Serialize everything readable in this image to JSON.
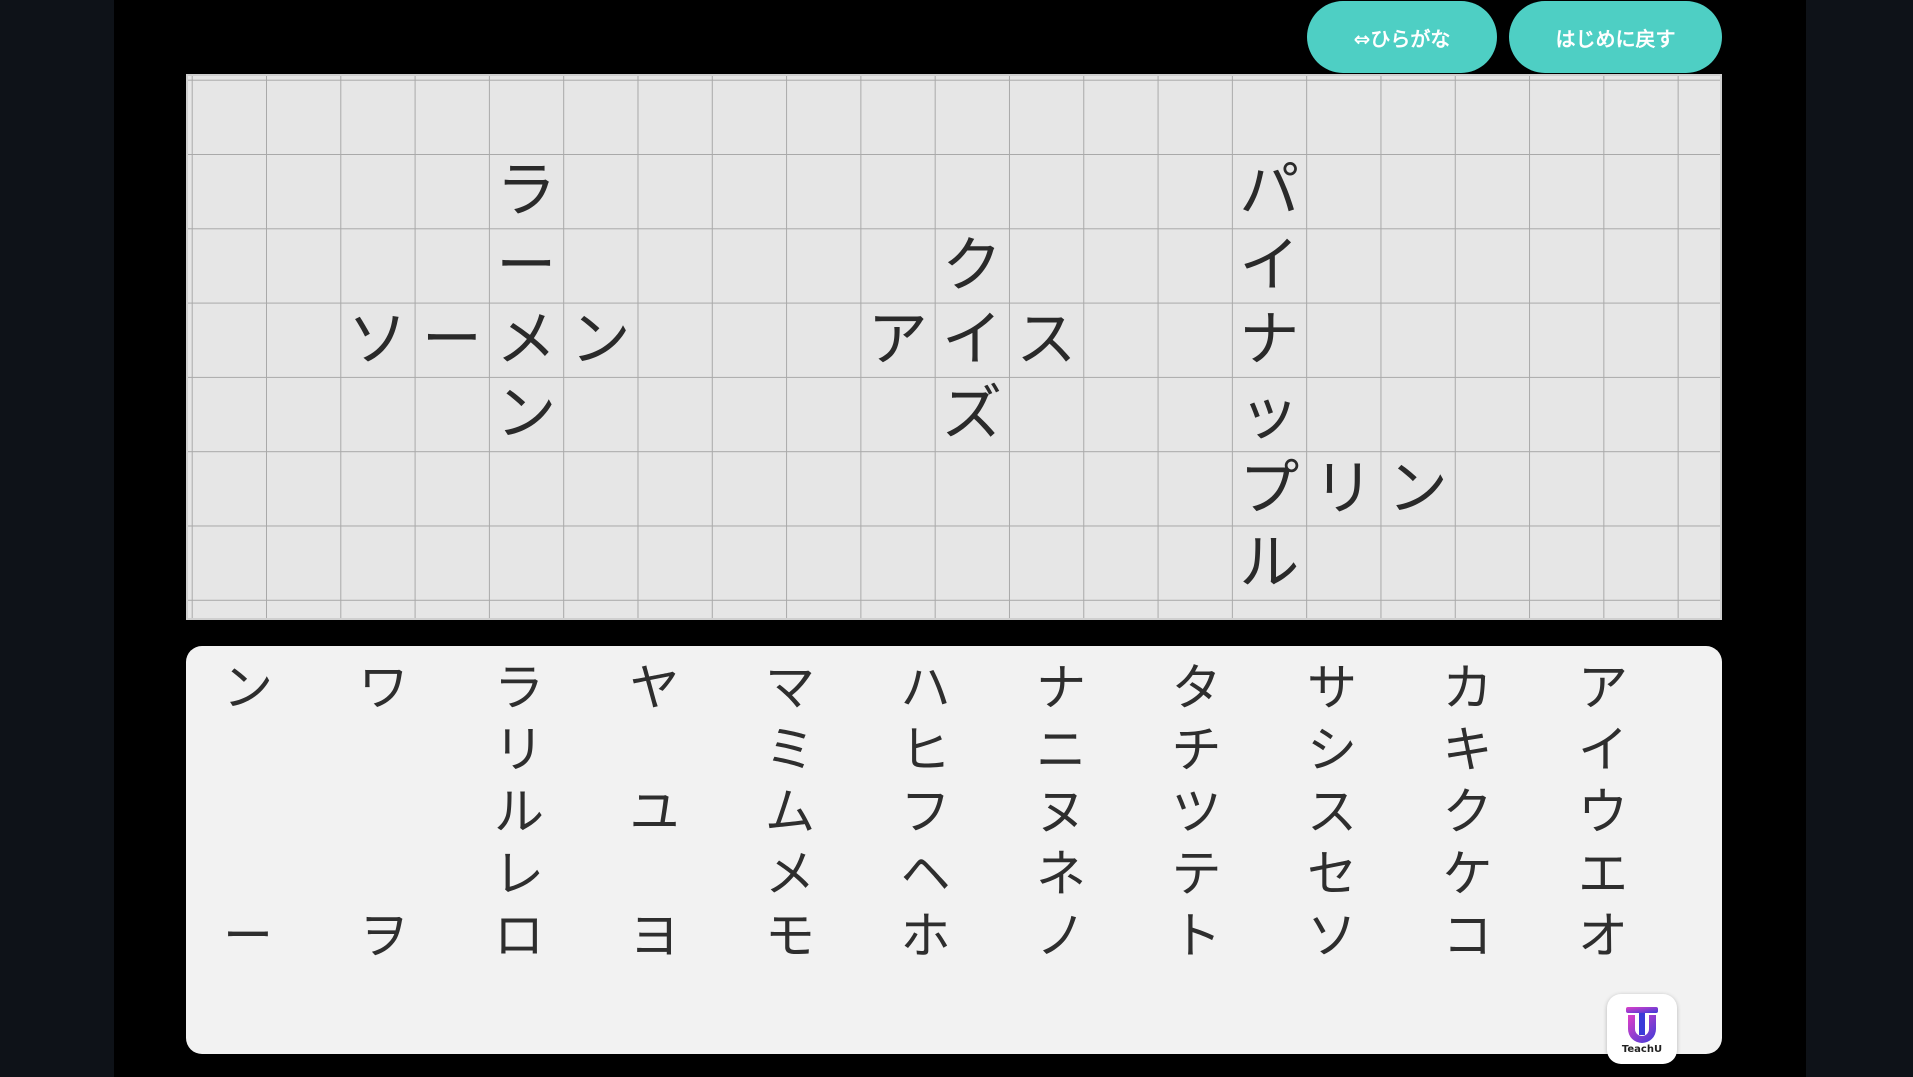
{
  "header": {
    "toggle_label": "⇔ひらがな",
    "reset_label": "はじめに戻す"
  },
  "board": {
    "rows": [
      [
        "",
        "",
        "",
        "",
        "",
        "",
        "",
        "",
        "",
        "",
        "",
        "",
        "",
        "",
        "",
        "",
        "",
        "",
        "",
        "",
        ""
      ],
      [
        "",
        "",
        "",
        "",
        "ラ",
        "",
        "",
        "",
        "",
        "",
        "",
        "",
        "",
        "",
        "パ",
        "",
        "",
        "",
        "",
        "",
        ""
      ],
      [
        "",
        "",
        "",
        "",
        "ー",
        "",
        "",
        "",
        "",
        "",
        "ク",
        "",
        "",
        "",
        "イ",
        "",
        "",
        "",
        "",
        "",
        ""
      ],
      [
        "",
        "",
        "ソ",
        "ー",
        "メ",
        "ン",
        "",
        "",
        "",
        "ア",
        "イ",
        "ス",
        "",
        "",
        "ナ",
        "",
        "",
        "",
        "",
        "",
        ""
      ],
      [
        "",
        "",
        "",
        "",
        "ン",
        "",
        "",
        "",
        "",
        "",
        "ズ",
        "",
        "",
        "",
        "ッ",
        "",
        "",
        "",
        "",
        "",
        ""
      ],
      [
        "",
        "",
        "",
        "",
        "",
        "",
        "",
        "",
        "",
        "",
        "",
        "",
        "",
        "",
        "プ",
        "リ",
        "ン",
        "",
        "",
        "",
        ""
      ],
      [
        "",
        "",
        "",
        "",
        "",
        "",
        "",
        "",
        "",
        "",
        "",
        "",
        "",
        "",
        "ル",
        "",
        "",
        "",
        "",
        "",
        ""
      ]
    ]
  },
  "keyboard": {
    "columns": [
      [
        "ン",
        "",
        "",
        "",
        "ー"
      ],
      [
        "ワ",
        "",
        "",
        "",
        "ヲ"
      ],
      [
        "ラ",
        "リ",
        "ル",
        "レ",
        "ロ"
      ],
      [
        "ヤ",
        "",
        "ユ",
        "",
        "ヨ"
      ],
      [
        "マ",
        "ミ",
        "ム",
        "メ",
        "モ"
      ],
      [
        "ハ",
        "ヒ",
        "フ",
        "ヘ",
        "ホ"
      ],
      [
        "ナ",
        "ニ",
        "ヌ",
        "ネ",
        "ノ"
      ],
      [
        "タ",
        "チ",
        "ツ",
        "テ",
        "ト"
      ],
      [
        "サ",
        "シ",
        "ス",
        "セ",
        "ソ"
      ],
      [
        "カ",
        "キ",
        "ク",
        "ケ",
        "コ"
      ],
      [
        "ア",
        "イ",
        "ウ",
        "エ",
        "オ"
      ]
    ]
  },
  "logo": {
    "text": "TeachU",
    "icon": "teachu-logo-icon"
  },
  "colors": {
    "accent": "#4ecfc4",
    "board_bg": "#e6e6e6",
    "keyboard_bg": "#f2f2f2",
    "stage_bg": "#000000",
    "outer_bg": "#0e1218"
  }
}
